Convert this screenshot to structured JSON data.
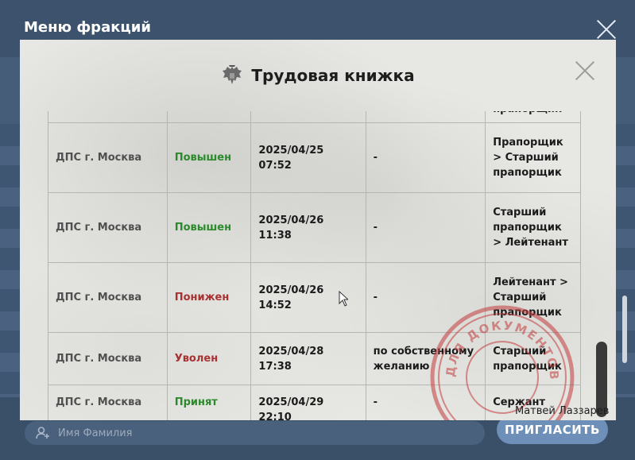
{
  "faction_menu": {
    "title": "Меню фракций",
    "invite_placeholder": "Имя Фамилия",
    "invite_button": "ПРИГЛАСИТЬ",
    "player_name": "Матвей Лаззарев"
  },
  "document": {
    "title": "Трудовая книжка",
    "stamp_text": "ДЛЯ ДОКУМЕНТОВ",
    "rows": [
      {
        "org": "",
        "status": "",
        "status_color": "",
        "date": "",
        "reason": "",
        "rank": "прапорщик"
      },
      {
        "org": "ДПС г. Москва",
        "status": "Повышен",
        "status_color": "#2b8a2b",
        "date": "2025/04/25 07:52",
        "reason": "-",
        "rank": "Прапорщик > Старший прапорщик"
      },
      {
        "org": "ДПС г. Москва",
        "status": "Повышен",
        "status_color": "#2b8a2b",
        "date": "2025/04/26 11:38",
        "reason": "-",
        "rank": "Старший прапорщик > Лейтенант"
      },
      {
        "org": "ДПС г. Москва",
        "status": "Понижен",
        "status_color": "#a83232",
        "date": "2025/04/26 14:52",
        "reason": "-",
        "rank": "Лейтенант > Старший прапорщик"
      },
      {
        "org": "ДПС г. Москва",
        "status": "Уволен",
        "status_color": "#a83232",
        "date": "2025/04/28 17:38",
        "reason": "по собственному желанию",
        "rank": "Старший прапорщик"
      },
      {
        "org": "ДПС г. Москва",
        "status": "Принят",
        "status_color": "#2b8a2b",
        "date": "2025/04/29 22:10",
        "reason": "-",
        "rank": "Сержант"
      }
    ]
  },
  "icons": {
    "close": "close-icon",
    "emblem": "double-headed-eagle-icon",
    "user": "add-user-icon"
  }
}
